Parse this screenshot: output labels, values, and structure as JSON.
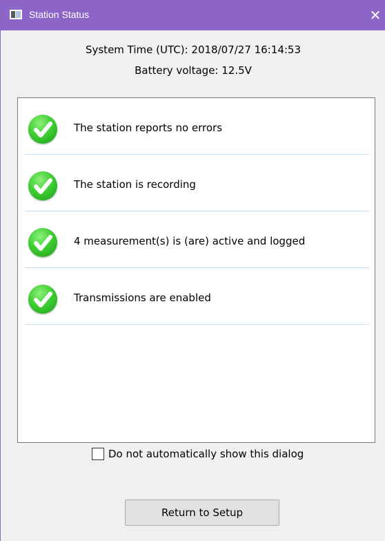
{
  "window": {
    "title": "Station Status",
    "close_glyph": "✕",
    "title_icon": "window-app-icon",
    "accent_color": "#8d65c8"
  },
  "header": {
    "system_time": "System Time (UTC): 2018/07/27 16:14:53",
    "battery": "Battery voltage: 12.5V"
  },
  "status_items": [
    {
      "icon": "green-check-icon",
      "text": "The station reports no errors"
    },
    {
      "icon": "green-check-icon",
      "text": "The station is recording"
    },
    {
      "icon": "green-check-icon",
      "text": "4 measurement(s) is (are) active and logged"
    },
    {
      "icon": "green-check-icon",
      "text": "Transmissions are enabled"
    }
  ],
  "footer": {
    "checkbox_label": "Do not automatically show this dialog",
    "checkbox_checked": false,
    "return_button": "Return to Setup"
  },
  "colors": {
    "status_ok": "#3ecf32",
    "divider": "#c9dff0"
  }
}
